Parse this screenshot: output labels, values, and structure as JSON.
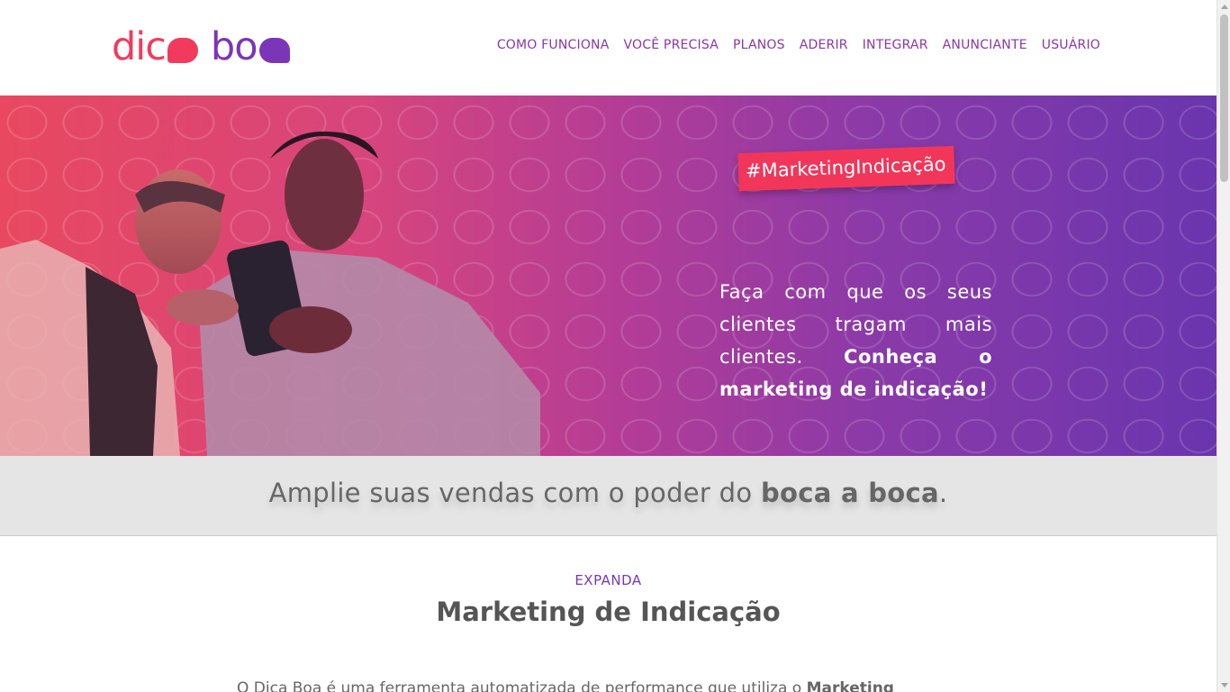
{
  "brand": {
    "logo_part1": "dic",
    "logo_part2": "b",
    "logo_part2_end": "o",
    "colors": {
      "pink": "#f23a5e",
      "purple": "#7b35b8",
      "nav": "#8a36a8"
    }
  },
  "nav": {
    "items": [
      "COMO FUNCIONA",
      "VOCÊ PRECISA",
      "PLANOS",
      "ADERIR",
      "INTEGRAR",
      "ANUNCIANTE",
      "USUÁRIO"
    ]
  },
  "hero": {
    "hashtag": "#MarketingIndicação",
    "text_regular": "Faça com que os seus clientes tragam mais clientes. ",
    "text_bold": "Conheça o marketing de indicação!"
  },
  "band": {
    "text_regular": "Amplie suas vendas com o poder do ",
    "text_bold": "boca a boca",
    "text_end": "."
  },
  "section": {
    "eyebrow": "EXPANDA",
    "title": "Marketing de Indicação",
    "body_regular": "O Dica Boa é uma ferramenta automatizada de performance que utiliza o ",
    "body_bold": "Marketing"
  }
}
